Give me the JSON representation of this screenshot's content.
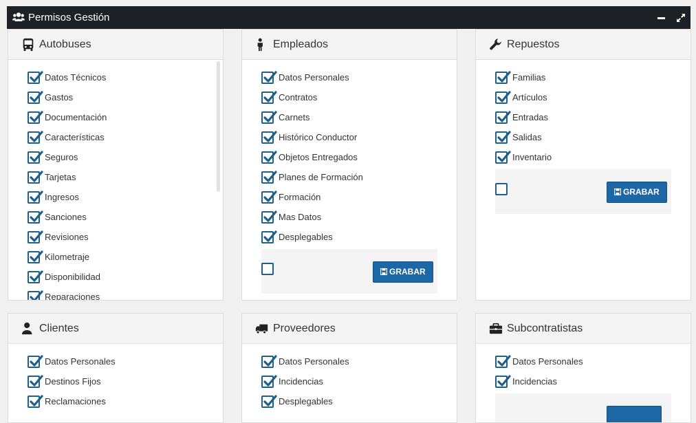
{
  "window": {
    "title": "Permisos Gestión",
    "title_icon": "users-icon",
    "minimize_icon": "minimize-icon",
    "expand_icon": "expand-icon"
  },
  "panels": [
    {
      "title": "Autobuses",
      "icon": "bus-icon",
      "items": [
        "Datos Técnicos",
        "Gastos",
        "Documentación",
        "Características",
        "Seguros",
        "Tarjetas",
        "Ingresos",
        "Sanciones",
        "Revisiones",
        "Kilometraje",
        "Disponibilidad",
        "Reparaciones"
      ]
    },
    {
      "title": "Empleados",
      "icon": "person-icon",
      "items": [
        "Datos Personales",
        "Contratos",
        "Carnets",
        "Histórico Conductor",
        "Objetos Entregados",
        "Planes de Formación",
        "Formación",
        "Mas Datos",
        "Desplegables"
      ],
      "button": "GRABAR"
    },
    {
      "title": "Repuestos",
      "icon": "wrench-icon",
      "items": [
        "Familias",
        "Artículos",
        "Entradas",
        "Salidas",
        "Inventario"
      ],
      "button": "GRABAR"
    },
    {
      "title": "Clientes",
      "icon": "user-icon",
      "items": [
        "Datos Personales",
        "Destinos Fijos",
        "Reclamaciones"
      ]
    },
    {
      "title": "Proveedores",
      "icon": "truck-icon",
      "items": [
        "Datos Personales",
        "Incidencias",
        "Desplegables"
      ]
    },
    {
      "title": "Subcontratistas",
      "icon": "briefcase-icon",
      "items": [
        "Datos Personales",
        "Incidencias"
      ]
    }
  ],
  "colors": {
    "topbar": "#1d2126",
    "checkbox": "#1f5f8c",
    "button": "#1e67a6"
  }
}
